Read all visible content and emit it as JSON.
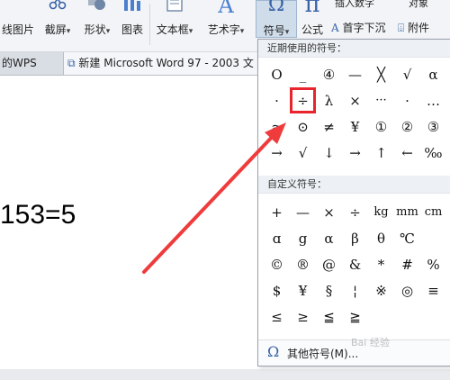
{
  "ribbon": {
    "items": [
      {
        "label": "线图片",
        "dd": ""
      },
      {
        "label": "截屏",
        "dd": "▾"
      },
      {
        "label": "形状",
        "dd": "▾"
      },
      {
        "label": "图表",
        "dd": ""
      },
      {
        "label": "文本框",
        "dd": "▾"
      },
      {
        "label": "艺术字",
        "dd": "▾"
      },
      {
        "label": "符号",
        "dd": "▾"
      },
      {
        "label": "公式",
        "dd": ""
      }
    ],
    "right_top": "插入数字",
    "right_top2": "对象",
    "first_letter": "首字下沉",
    "attachment": "附件"
  },
  "tabs": {
    "wps": "的WPS",
    "doc": "新建 Microsoft Word 97 - 2003 文"
  },
  "document": {
    "text": "153=5"
  },
  "symbol_panel": {
    "recent_header": "近期使用的符号：",
    "recent": [
      "O",
      "_",
      "④",
      "—",
      "╳",
      "√",
      "α",
      "·",
      "÷",
      "λ",
      "×",
      "···",
      "·",
      "…",
      "≈",
      "⊙",
      "≠",
      "¥",
      "①",
      "②",
      "③",
      "→",
      "√",
      "↓",
      "→",
      "↑",
      "←",
      "‰"
    ],
    "custom_header": "自定义符号：",
    "custom": [
      "+",
      "—",
      "×",
      "÷",
      "kg",
      "mm",
      "cm",
      "ɑ",
      "g",
      "α",
      "β",
      "θ",
      "℃",
      "",
      "©",
      "®",
      "@",
      "&",
      "*",
      "#",
      "%",
      "$",
      "¥",
      "§",
      "¦",
      "※",
      "◎",
      "≡",
      "≤",
      "≥",
      "≦",
      "≧",
      "",
      "",
      ""
    ],
    "footer": "其他符号(M)..."
  },
  "watermark": "Bai 经验"
}
